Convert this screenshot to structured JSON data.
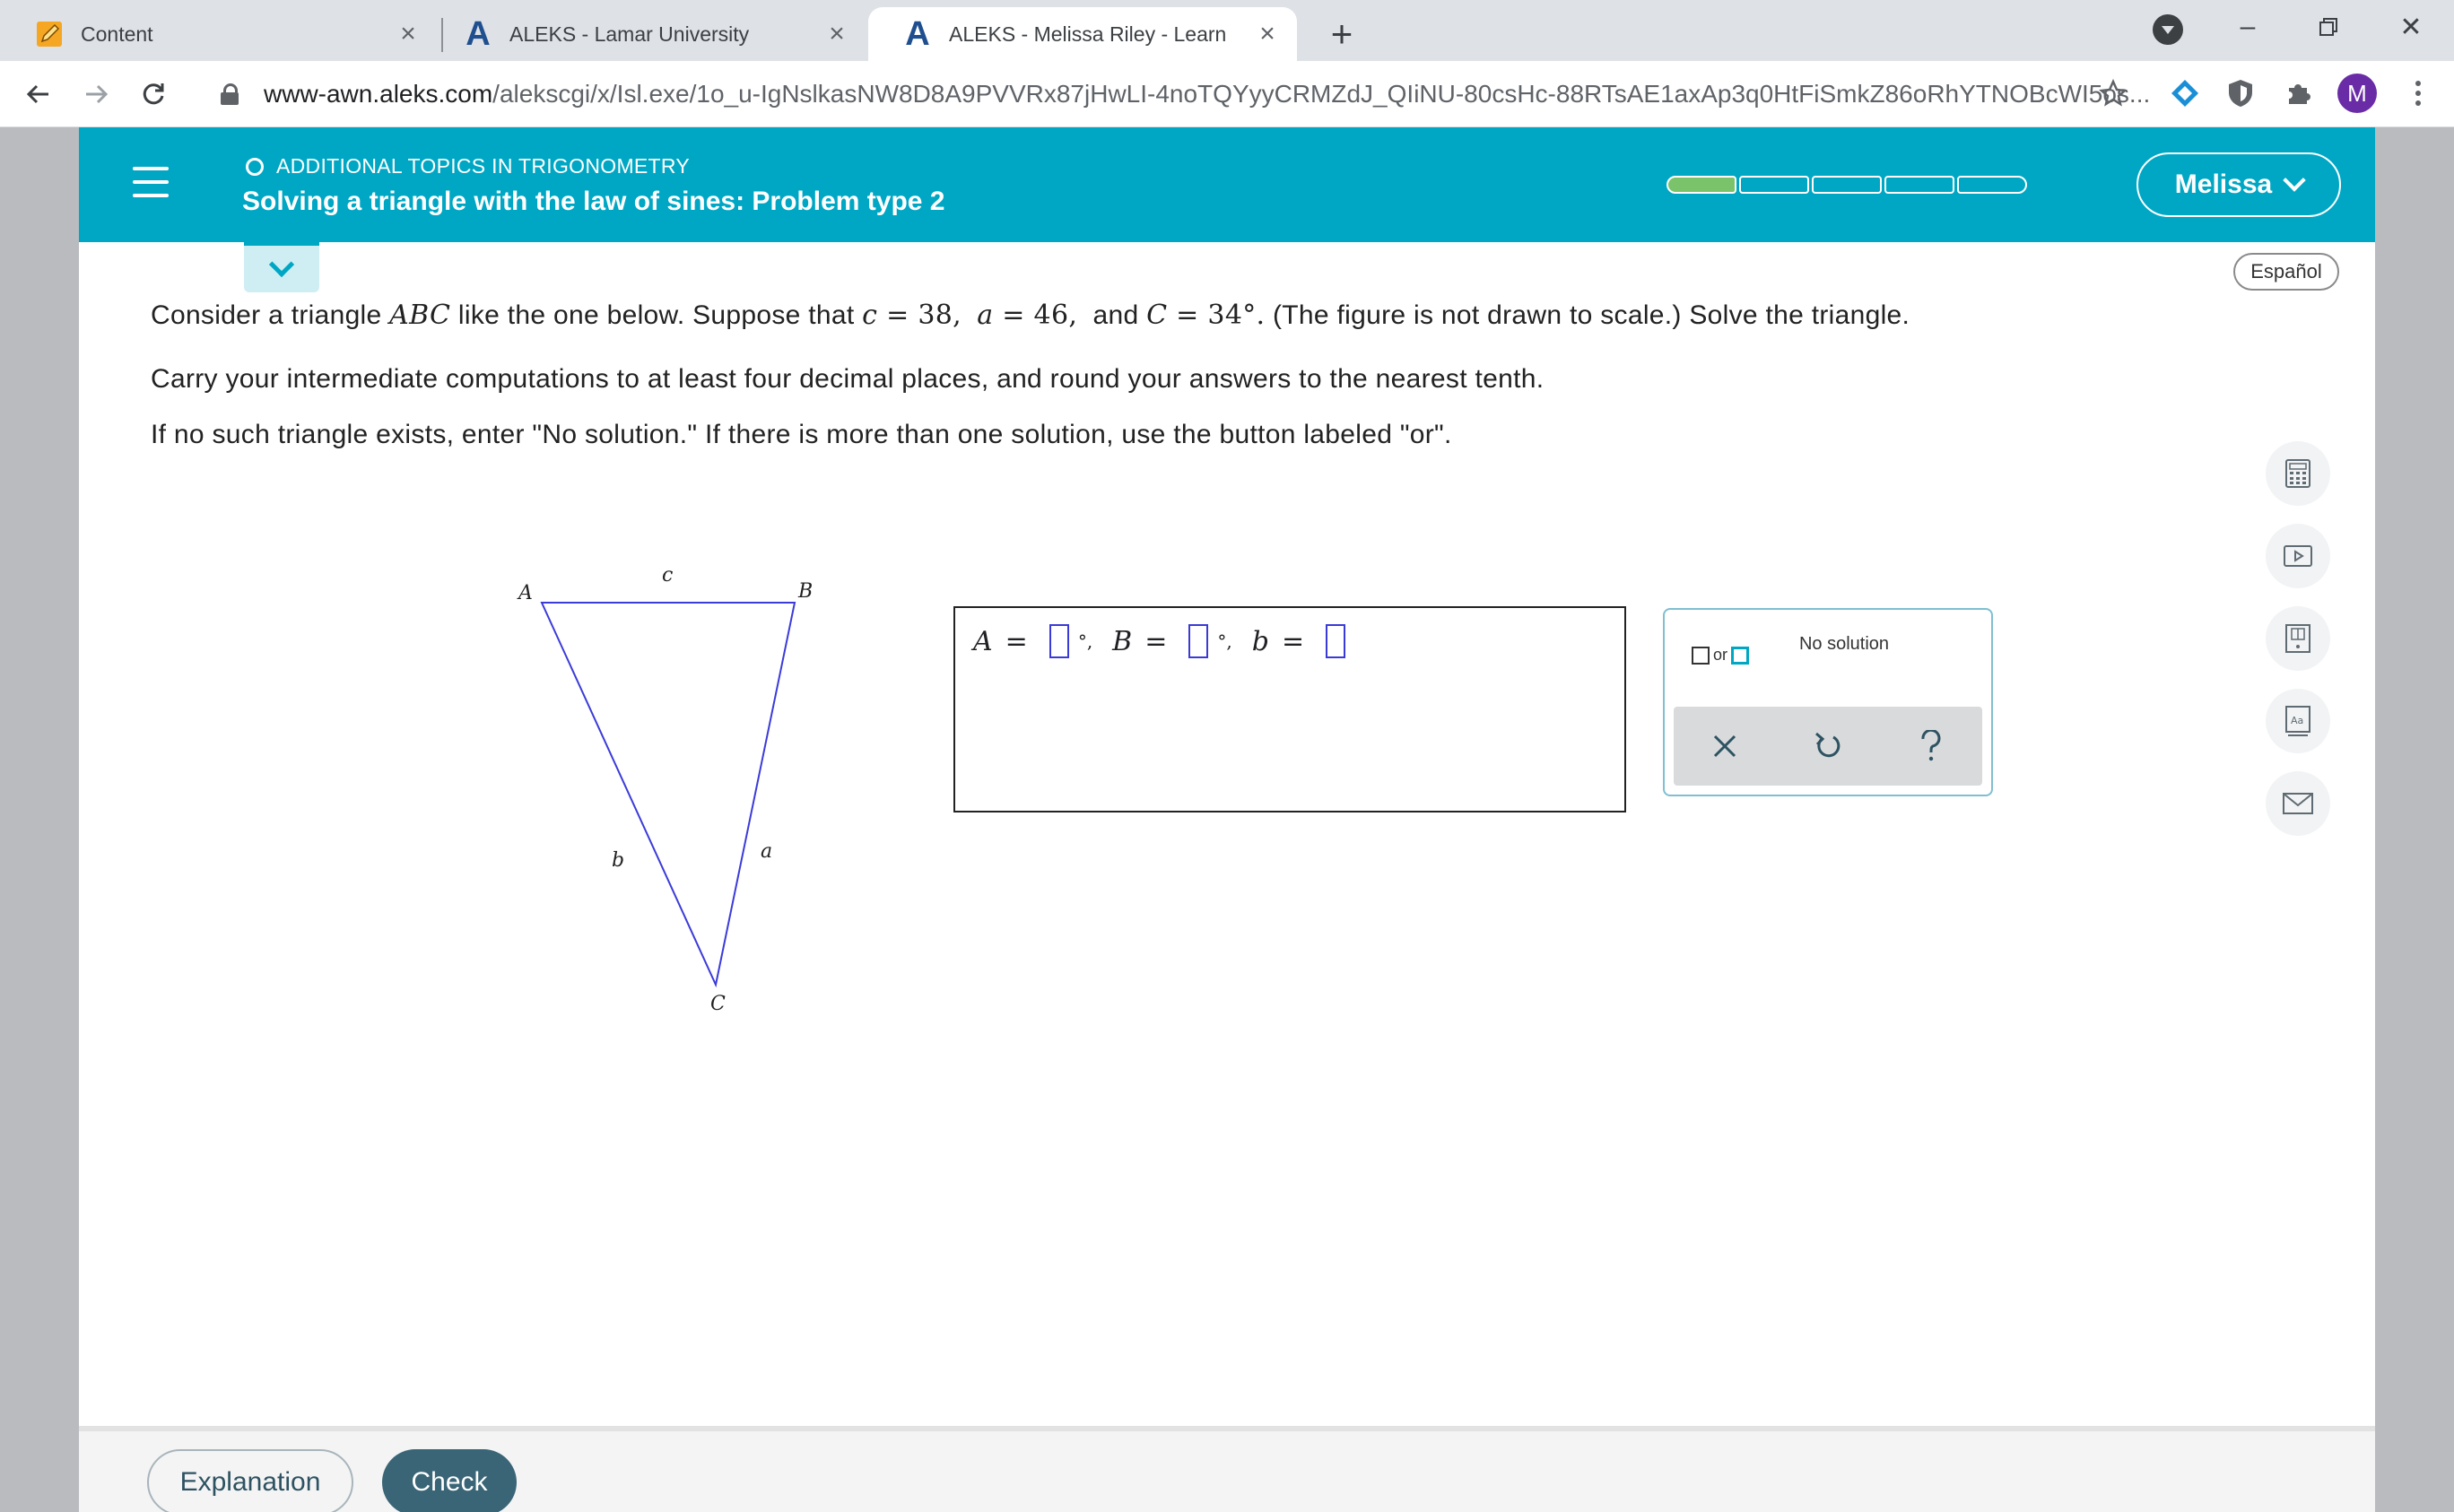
{
  "browser": {
    "tabs": [
      {
        "title": "Content",
        "icon": "pencil-icon"
      },
      {
        "title": "ALEKS - Lamar University",
        "icon": "aleks-icon"
      },
      {
        "title": "ALEKS - Melissa Riley - Learn",
        "icon": "aleks-icon",
        "active": true
      }
    ],
    "url_host": "www-awn.aleks.com",
    "url_path": "/alekscgi/x/Isl.exe/1o_u-IgNslkasNW8D8A9PVVRx87jHwLI-4noTQYyyCRMZdJ_QIiNU-80csHc-88RTsAE1axAp3q0HtFiSmkZ86oRhYTNOBcWI5os...",
    "profile_initial": "M"
  },
  "header": {
    "topic": "ADDITIONAL TOPICS IN TRIGONOMETRY",
    "lesson_title": "Solving a triangle with the law of sines: Problem type 2",
    "progress_filled": 1,
    "progress_total": 5,
    "user_name": "Melissa",
    "colors": {
      "header": "#00a7c4",
      "progress_fill": "#7ac36a"
    }
  },
  "language_button": "Español",
  "problem": {
    "line1_a": "Consider a triangle ",
    "line1_abc": "ABC",
    "line1_b": " like the one below. Suppose that ",
    "line1_c_var": "c",
    "line1_c_val": " = 38,",
    "line1_a_var": "a",
    "line1_a_val": " = 46,",
    "line1_and": "and ",
    "line1_C_var": "C",
    "line1_C_val": " = 34°.",
    "line1_end": " (The figure is not drawn to scale.) Solve the triangle.",
    "line2": "Carry your intermediate computations to at least four decimal places, and round your answers to the nearest tenth.",
    "line3": "If no such triangle exists, enter \"No solution.\" If there is more than one solution, use the button labeled \"or\"."
  },
  "figure": {
    "vertex_A": "A",
    "vertex_B": "B",
    "vertex_C": "C",
    "side_a": "a",
    "side_b": "b",
    "side_c": "c"
  },
  "answer": {
    "A_label": "A",
    "B_label": "B",
    "b_label": "b",
    "equals": "=",
    "degree": "°,",
    "A_value": "",
    "B_value": "",
    "b_value": ""
  },
  "keypad": {
    "or_label": "or",
    "no_solution": "No solution"
  },
  "footer": {
    "explanation": "Explanation",
    "check": "Check"
  }
}
